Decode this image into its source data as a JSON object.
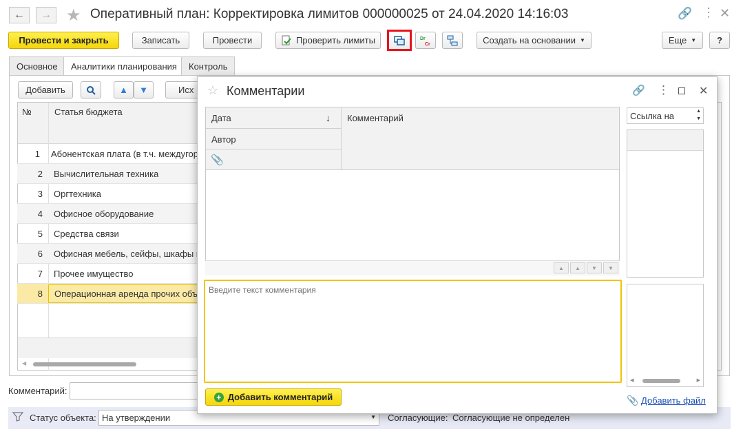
{
  "window": {
    "title": "Оперативный план: Корректировка лимитов 000000025 от 24.04.2020 14:16:03"
  },
  "toolbar": {
    "post_close": "Провести и закрыть",
    "save": "Записать",
    "post": "Провести",
    "check_limits": "Проверить лимиты",
    "create_based": "Создать на основании",
    "more": "Еще",
    "help": "?"
  },
  "tabs": [
    "Основное",
    "Аналитики планирования",
    "Контроль"
  ],
  "grid": {
    "add_button": "Добавить",
    "source_button": "Исх",
    "columns": [
      "№",
      "Статья бюджета"
    ],
    "rows": [
      {
        "num": "1",
        "item": "Абонентская плата (в т.ч. междугородная"
      },
      {
        "num": "2",
        "item": "Вычислительная техника"
      },
      {
        "num": "3",
        "item": "Оргтехника"
      },
      {
        "num": "4",
        "item": "Офисное оборудование"
      },
      {
        "num": "5",
        "item": "Средства связи"
      },
      {
        "num": "6",
        "item": "Офисная мебель, сейфы, шкафы м"
      },
      {
        "num": "7",
        "item": "Прочее имущество"
      },
      {
        "num": "8",
        "item": "Операционная аренда прочих объ"
      }
    ]
  },
  "footer": {
    "comment_label": "Комментарий:",
    "status_label": "Статус объекта:",
    "status_value": "На утверждении",
    "approvers_label": "Согласующие:",
    "approvers_value": "Согласующие не определен"
  },
  "dialog": {
    "title": "Комментарии",
    "col_date": "Дата",
    "col_author": "Автор",
    "col_comment": "Комментарий",
    "link_select": "Ссылка на",
    "input_placeholder": "Введите текст комментария",
    "add_comment": "Добавить комментарий",
    "add_file": "Добавить файл"
  },
  "colors": {
    "accent_yellow": "#f5d60a",
    "selected_row": "#fbeaa5",
    "highlight_red": "#e8131c",
    "link_blue": "#1a4fb5"
  }
}
